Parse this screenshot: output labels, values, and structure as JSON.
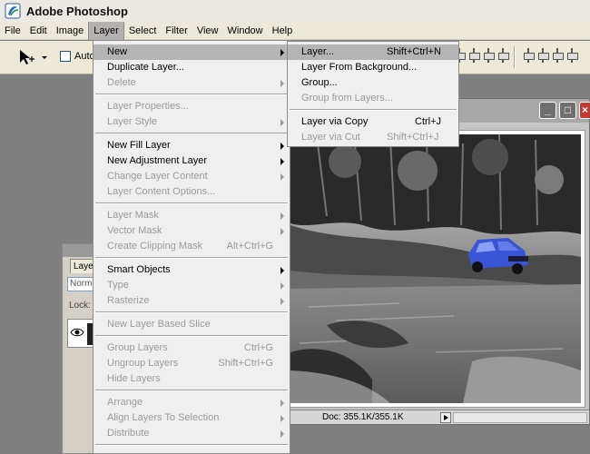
{
  "window": {
    "title": "Adobe Photoshop",
    "icon": "photoshop-app-icon"
  },
  "menubar": {
    "items": [
      "File",
      "Edit",
      "Image",
      "Layer",
      "Select",
      "Filter",
      "View",
      "Window",
      "Help"
    ]
  },
  "options_bar": {
    "auto_select_label": "Auto"
  },
  "layer_menu": {
    "new": "New",
    "duplicate_layer": "Duplicate Layer...",
    "delete": "Delete",
    "layer_properties": "Layer Properties...",
    "layer_style": "Layer Style",
    "new_fill_layer": "New Fill Layer",
    "new_adjustment_layer": "New Adjustment Layer",
    "change_layer_content": "Change Layer Content",
    "layer_content_options": "Layer Content Options...",
    "layer_mask": "Layer Mask",
    "vector_mask": "Vector Mask",
    "create_clipping_mask": "Create Clipping Mask",
    "create_clipping_mask_shortcut": "Alt+Ctrl+G",
    "smart_objects": "Smart Objects",
    "type": "Type",
    "rasterize": "Rasterize",
    "new_layer_based_slice": "New Layer Based Slice",
    "group_layers": "Group Layers",
    "group_layers_shortcut": "Ctrl+G",
    "ungroup_layers": "Ungroup Layers",
    "ungroup_layers_shortcut": "Shift+Ctrl+G",
    "hide_layers": "Hide Layers",
    "arrange": "Arrange",
    "align_layers_to_selection": "Align Layers To Selection",
    "distribute": "Distribute"
  },
  "new_submenu": {
    "layer": "Layer...",
    "layer_shortcut": "Shift+Ctrl+N",
    "layer_from_background": "Layer From Background...",
    "group": "Group...",
    "group_from_layers": "Group from Layers...",
    "layer_via_copy": "Layer via Copy",
    "layer_via_copy_shortcut": "Ctrl+J",
    "layer_via_cut": "Layer via Cut",
    "layer_via_cut_shortcut": "Shift+Ctrl+J"
  },
  "layers_panel": {
    "tab_label": "Layers",
    "blend_mode": "Normal",
    "lock_label": "Lock:"
  },
  "document": {
    "status_text": "Doc: 355.1K/355.1K"
  },
  "colors": {
    "menu_highlight": "#b4b4b4",
    "car_blue": "#3a54d6",
    "close_button": "#c13a2f"
  }
}
